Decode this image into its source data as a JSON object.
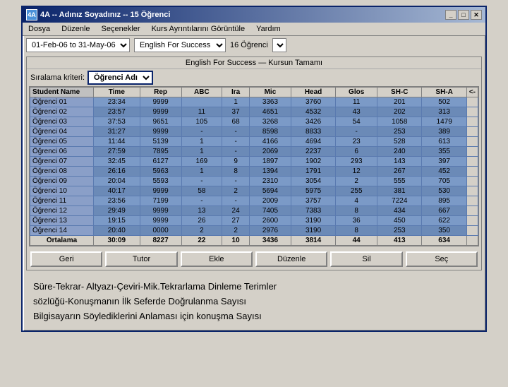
{
  "window": {
    "title": "4A -- Adınız Soyadınız -- 15  Öğrenci",
    "icon": "4A"
  },
  "menu": {
    "items": [
      "Dosya",
      "Düzenle",
      "Seçenekler",
      "Kurs Ayrıntılarını Görüntüle",
      "Yardım"
    ]
  },
  "toolbar": {
    "date_range": "01-Feb-06  to  31-May-06",
    "course": "English For Success",
    "student_count": "16 Öğrenci"
  },
  "course_title": "English For Success — Kursun Tamamı",
  "sort": {
    "label": "Sıralama kriteri:",
    "value": "Öğrenci Adı"
  },
  "table": {
    "headers": [
      "Student Name",
      "Time",
      "Rep",
      "ABC",
      "Ira",
      "Mic",
      "Head",
      "Glos",
      "SH-C",
      "SH-A",
      "<-"
    ],
    "rows": [
      [
        "Öğrenci 01",
        "23:34",
        "9999",
        "",
        "1",
        "3363",
        "3760",
        "11",
        "201",
        "502"
      ],
      [
        "Öğrenci 02",
        "23:57",
        "9999",
        "11",
        "37",
        "4651",
        "4532",
        "43",
        "202",
        "313"
      ],
      [
        "Öğrenci 03",
        "37:53",
        "9651",
        "105",
        "68",
        "3268",
        "3426",
        "54",
        "1058",
        "1479"
      ],
      [
        "Öğrenci 04",
        "31:27",
        "9999",
        "-",
        "-",
        "8598",
        "8833",
        "-",
        "253",
        "389"
      ],
      [
        "Öğrenci 05",
        "11:44",
        "5139",
        "1",
        "-",
        "4166",
        "4694",
        "23",
        "528",
        "613"
      ],
      [
        "Öğrenci 06",
        "27:59",
        "7895",
        "1",
        "-",
        "2069",
        "2237",
        "6",
        "240",
        "355"
      ],
      [
        "Öğrenci 07",
        "32:45",
        "6127",
        "169",
        "9",
        "1897",
        "1902",
        "293",
        "143",
        "397"
      ],
      [
        "Öğrenci 08",
        "26:16",
        "5963",
        "1",
        "8",
        "1394",
        "1791",
        "12",
        "267",
        "452"
      ],
      [
        "Öğrenci 09",
        "20:04",
        "5593",
        "-",
        "-",
        "2310",
        "3054",
        "2",
        "555",
        "705"
      ],
      [
        "Öğrenci 10",
        "40:17",
        "9999",
        "58",
        "2",
        "5694",
        "5975",
        "255",
        "381",
        "530"
      ],
      [
        "Öğrenci 11",
        "23:56",
        "7199",
        "-",
        "-",
        "2009",
        "3757",
        "4",
        "7224",
        "895"
      ],
      [
        "Öğrenci 12",
        "29:49",
        "9999",
        "13",
        "24",
        "7405",
        "7383",
        "8",
        "434",
        "667"
      ],
      [
        "Öğrenci 13",
        "19:15",
        "9999",
        "26",
        "27",
        "2600",
        "3190",
        "36",
        "450",
        "622"
      ],
      [
        "Öğrenci 14",
        "20:40",
        "0000",
        "2",
        "2",
        "2976",
        "3190",
        "8",
        "253",
        "350"
      ]
    ],
    "avg_row": [
      "Ortalama",
      "30:09",
      "8227",
      "22",
      "10",
      "3436",
      "3814",
      "44",
      "413",
      "634"
    ]
  },
  "buttons": [
    "Geri",
    "Tutor",
    "Ekle",
    "Düzenle",
    "Sil",
    "Seç"
  ],
  "footer": {
    "line1": "Süre-Tekrar- Altyazı-Çeviri-Mik.Tekrarlama Dinleme Terimler",
    "line2": "sözlüğü-Konuşmanın İlk Seferde  Doğrulanma Sayısı",
    "line3": "Bilgisayarın Söylediklerini Anlaması için konuşma Sayısı"
  }
}
